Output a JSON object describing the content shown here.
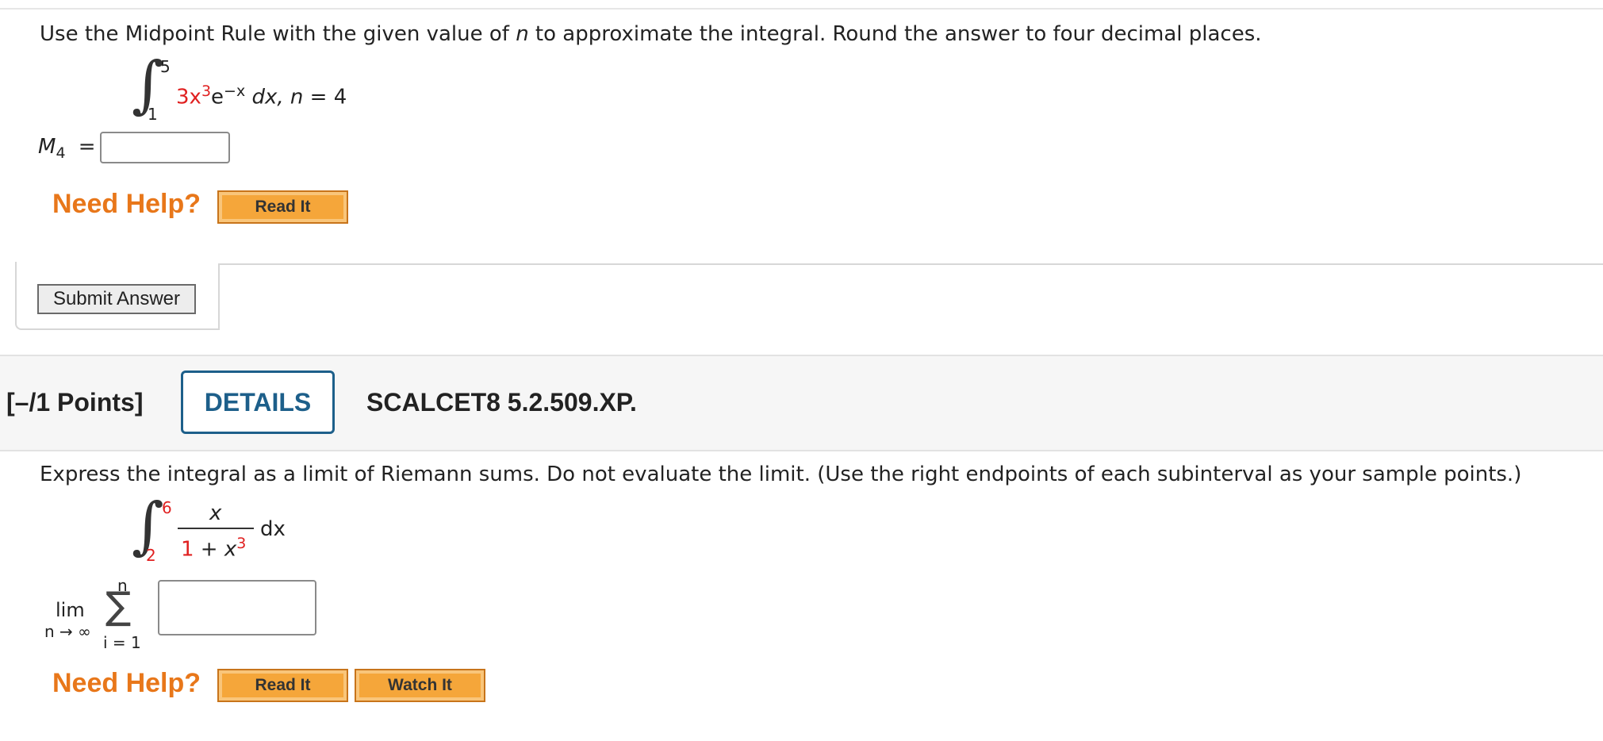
{
  "q1": {
    "prompt_before": "Use the Midpoint Rule with the given value of ",
    "prompt_var": "n",
    "prompt_after": " to approximate the integral. Round the answer to four decimal places.",
    "integral": {
      "upper": "5",
      "lower": "1",
      "coef": "3",
      "x": "x",
      "exp3": "3",
      "e": "e",
      "exp_neg": "−x",
      "dx": "dx,",
      "n_label": "n",
      "n_eq": "= 4"
    },
    "answer_label_main": "M",
    "answer_label_sub": "4",
    "answer_eq": "=",
    "answer_value": "",
    "need_help": "Need Help?",
    "read_it": "Read It",
    "submit": "Submit Answer"
  },
  "q2": {
    "points": "[–/1 Points]",
    "details": "DETAILS",
    "code": "SCALCET8 5.2.509.XP.",
    "prompt": "Express the integral as a limit of Riemann sums. Do not evaluate the limit. (Use the right endpoints of each subinterval as your sample points.)",
    "integral": {
      "upper": "6",
      "lower": "2",
      "numerator": "x",
      "denom_one": "1",
      "denom_plus": " + ",
      "denom_x": "x",
      "denom_exp": "3",
      "dx": "dx"
    },
    "limit": {
      "lim": "lim",
      "sub": "n → ∞",
      "sigma": "∑",
      "sum_upper": "n",
      "sum_lower": "i = 1"
    },
    "answer_value": "",
    "need_help": "Need Help?",
    "read_it": "Read It",
    "watch_it": "Watch It"
  },
  "colors": {
    "accent_red": "#e02020",
    "help_orange": "#e8771a",
    "button_orange": "#f5a63a",
    "details_blue": "#1d5f8a"
  }
}
